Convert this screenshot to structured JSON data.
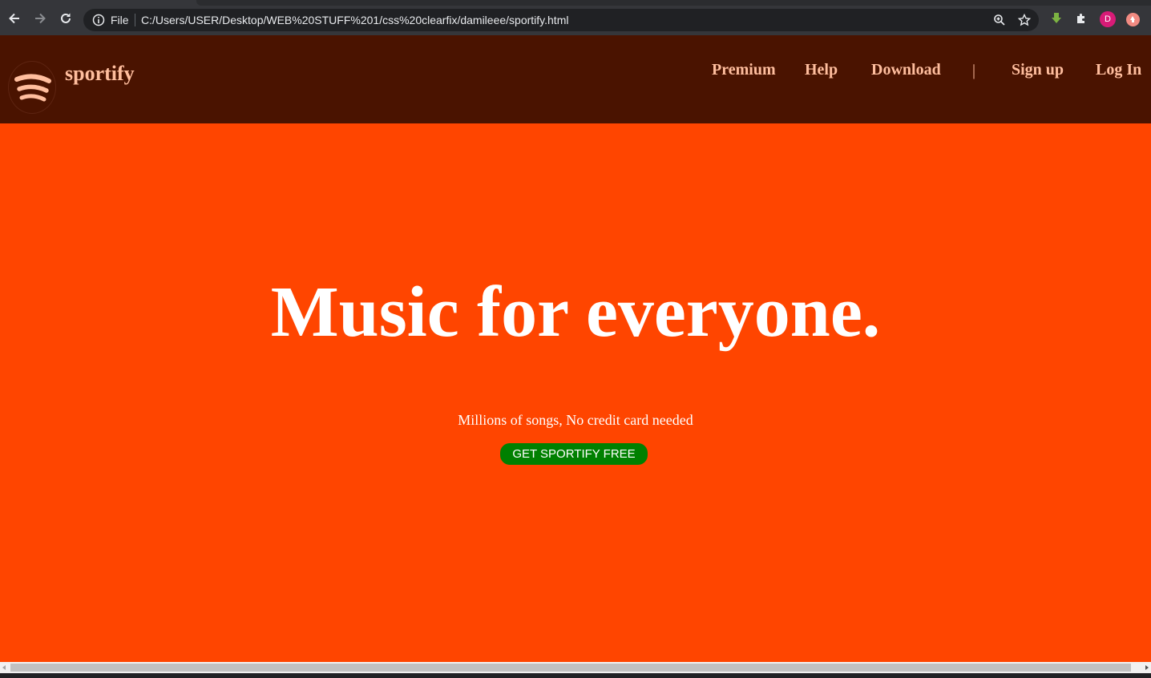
{
  "browser": {
    "scheme_label": "File",
    "url": "C:/Users/USER/Desktop/WEB%20STUFF%201/css%20clearfix/damileee/sportify.html",
    "profile_initial": "D",
    "icons": [
      "back-icon",
      "forward-icon",
      "reload-icon",
      "info-icon",
      "zoom-icon",
      "star-icon",
      "download-extension-icon",
      "puzzle-icon",
      "upload-extension-icon"
    ]
  },
  "header": {
    "brand": "sportify",
    "nav": {
      "premium": "Premium",
      "help": "Help",
      "download": "Download",
      "divider": "|",
      "signup": "Sign up",
      "login": "Log In"
    }
  },
  "hero": {
    "title": "Music for everyone.",
    "subtitle": "Millions of songs, No credit card needed",
    "cta": "GET SPORTIFY FREE"
  },
  "colors": {
    "header_bg": "#4a1300",
    "page_bg": "#ff4500",
    "nav_text": "#ffbe9e",
    "cta_bg": "#008000"
  }
}
